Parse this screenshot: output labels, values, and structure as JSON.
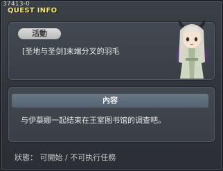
{
  "window": {
    "id_label": "37413-0",
    "title": "QUEST INFO"
  },
  "quest": {
    "tag": "活動",
    "name": "[圣地与圣剑]末端分叉的羽毛"
  },
  "npc": {
    "icon": "npc-portrait-icon"
  },
  "details": {
    "header": "內容",
    "text": "与伊蘂娜一起结束在王室图书馆的调查吧。"
  },
  "status": {
    "text": "狀態： 可開始 / 不可执行任務"
  },
  "colors": {
    "title": "#f2e86c",
    "background": "#2e3238",
    "panel": "#3e444b",
    "section_header": "#5f6c79"
  }
}
